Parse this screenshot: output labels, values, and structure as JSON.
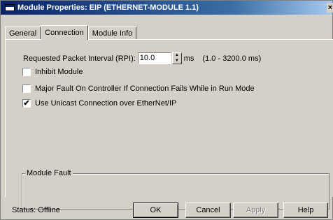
{
  "window": {
    "title": "Module Properties: EIP (ETHERNET-MODULE 1.1)",
    "close_glyph": "×"
  },
  "tabs": [
    {
      "label": "General",
      "active": false
    },
    {
      "label": "Connection",
      "active": true
    },
    {
      "label": "Module Info",
      "active": false
    }
  ],
  "connection": {
    "rpi_label": "Requested Packet Interval (RPI):",
    "rpi_value": "10.0",
    "rpi_unit": "ms",
    "rpi_range": "(1.0 - 3200.0 ms)",
    "inhibit_label": "Inhibit Module",
    "inhibit_checked": false,
    "major_fault_label": "Major Fault On Controller If Connection Fails While in Run Mode",
    "major_fault_checked": false,
    "unicast_label": "Use Unicast Connection over EtherNet/IP",
    "unicast_checked": true,
    "check_glyph": "✔"
  },
  "module_fault": {
    "label": "Module Fault",
    "text": ""
  },
  "footer": {
    "status": "Status:  Offline",
    "ok_label": "OK",
    "cancel_label": "Cancel",
    "apply_label": "Apply",
    "help_label": "Help"
  },
  "icons": {
    "title_icon": "window-app-icon",
    "spin_up": "▲",
    "spin_down": "▼"
  }
}
